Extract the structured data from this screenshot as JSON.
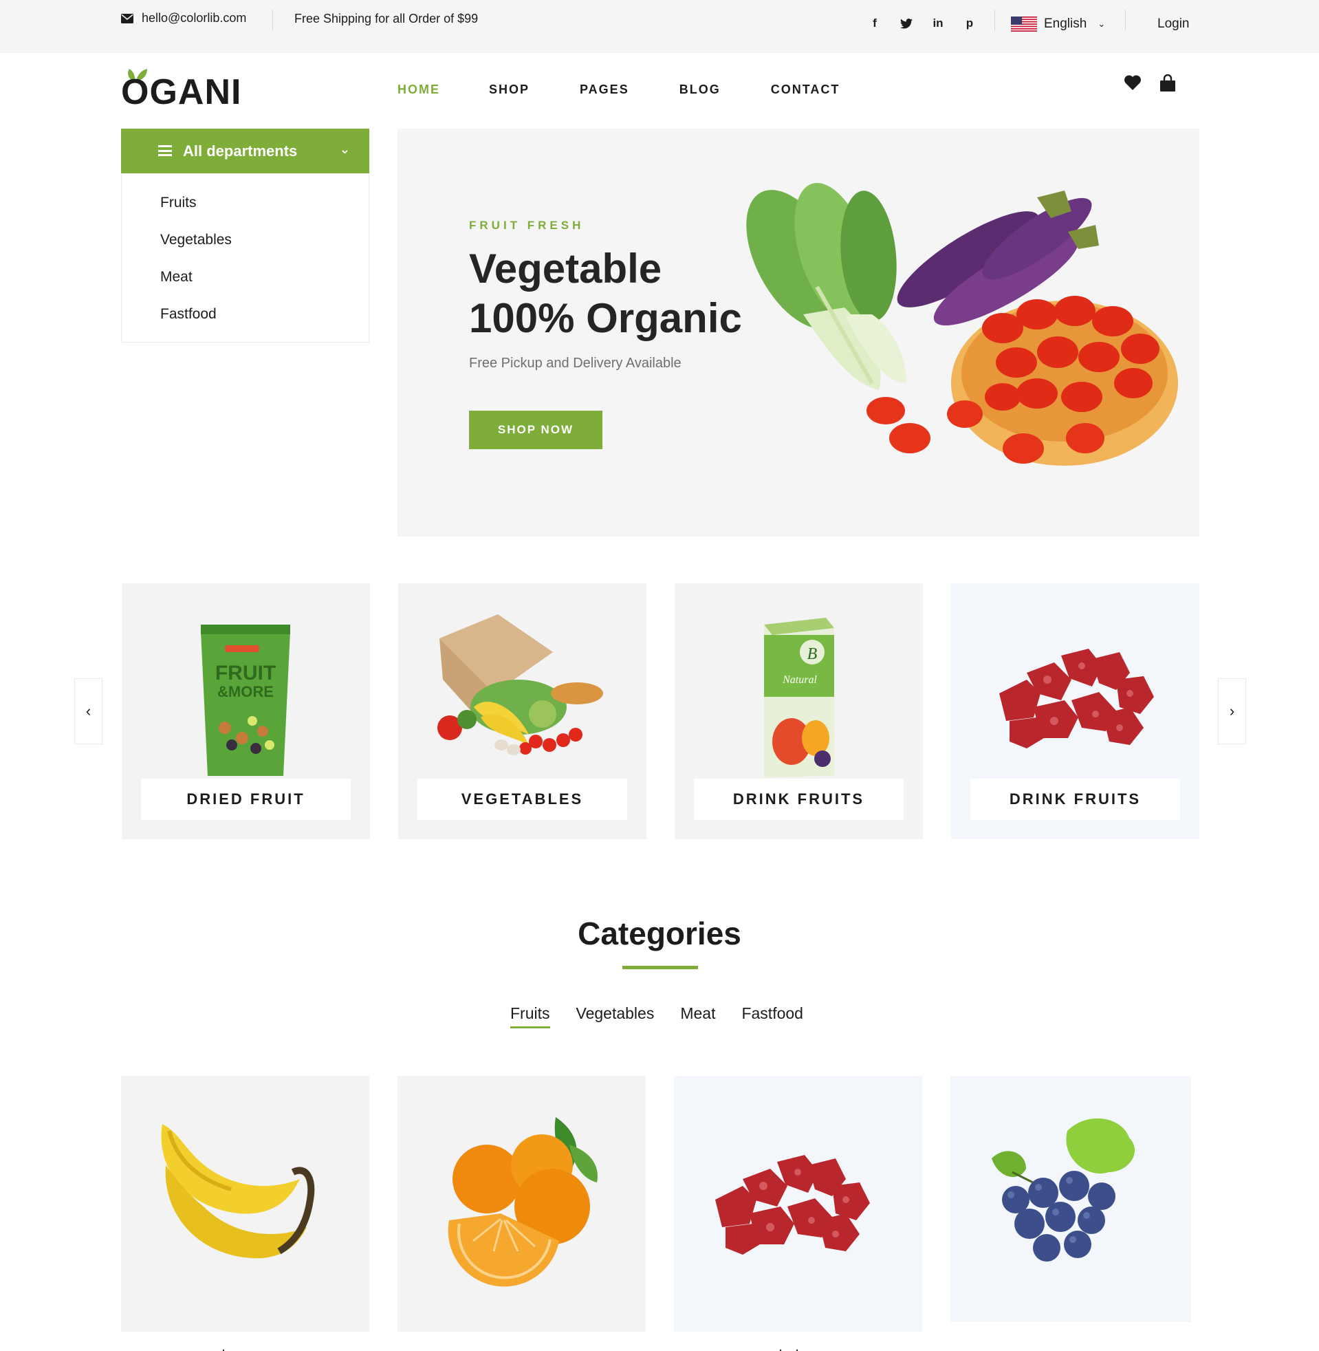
{
  "topbar": {
    "email": "hello@colorlib.com",
    "shipping": "Free Shipping for all Order of $99",
    "social": [
      "f",
      "t",
      "in",
      "p"
    ],
    "language": "English",
    "login": "Login"
  },
  "header": {
    "logo": "OGANI",
    "nav": [
      "HOME",
      "SHOP",
      "PAGES",
      "BLOG",
      "CONTACT"
    ],
    "active_nav": "HOME"
  },
  "departments": {
    "title": "All departments",
    "items": [
      "Fruits",
      "Vegetables",
      "Meat",
      "Fastfood"
    ]
  },
  "hero": {
    "kicker": "FRUIT FRESH",
    "title_line1": "Vegetable",
    "title_line2": "100% Organic",
    "subtitle": "Free Pickup and Delivery Available",
    "button": "SHOP NOW"
  },
  "carousel": {
    "items": [
      "DRIED FRUIT",
      "VEGETABLES",
      "DRINK FRUITS",
      "DRINK FRUITS"
    ],
    "pack_text": "FRUIT\n&MORE",
    "juice_text": "Natural"
  },
  "categories": {
    "title": "Categories",
    "filters": [
      "Fruits",
      "Vegetables",
      "Meat",
      "Fastfood"
    ],
    "active_filter": "Fruits",
    "products": [
      "banana",
      "orange",
      "meat",
      "grapes"
    ]
  },
  "colors": {
    "accent": "#7fad39",
    "dark": "#1c1c1c",
    "muted": "#6f6f6f",
    "panel": "#f3f3f3"
  }
}
